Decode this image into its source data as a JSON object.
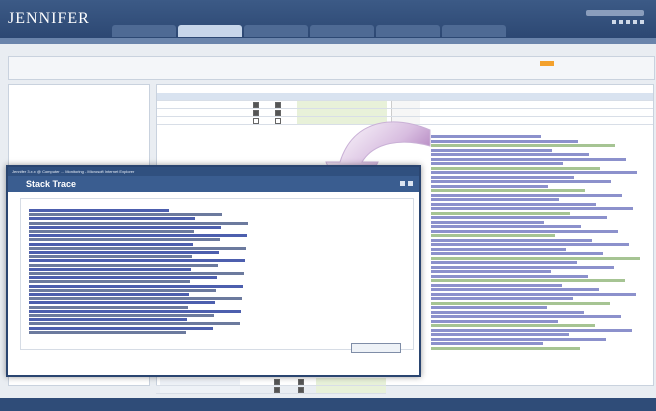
{
  "app": {
    "logo": "JENNIFER"
  },
  "tabs": [
    "",
    "",
    "",
    "",
    "",
    ""
  ],
  "active_tab_index": 1,
  "subnav": [
    "",
    "",
    "",
    ""
  ],
  "letters": [
    "",
    "",
    "",
    "",
    "",
    "",
    "",
    "",
    "",
    "",
    "",
    "",
    "",
    "",
    "",
    "",
    "",
    "",
    "",
    "",
    "",
    "",
    "",
    "",
    "",
    "",
    "",
    "",
    "",
    "",
    "",
    "",
    "",
    "",
    "",
    "",
    "",
    ""
  ],
  "active_letter_index": 31,
  "tree": {
    "items": [
      "",
      "",
      "",
      "",
      "",
      "",
      "",
      "",
      ""
    ]
  },
  "table": {
    "title": "",
    "headers": [
      "",
      "",
      "",
      "",
      "",
      ""
    ],
    "rows": [
      {
        "name": "",
        "c1": true,
        "c2": true,
        "timeout": ""
      },
      {
        "name": "",
        "c1": true,
        "c2": true,
        "timeout": ""
      },
      {
        "name": "",
        "c1": false,
        "c2": false,
        "timeout": ""
      }
    ]
  },
  "dialog": {
    "window_title": "Jennifer 3.x.x @ Computer ... Monitoring - Microsoft Internet Explorer",
    "title": "Stack Trace",
    "back_button": ""
  },
  "status": {
    "text": ""
  },
  "colors": {
    "arrow": "#7a2f8f",
    "accent": "#f3a12d",
    "header": "#30507f"
  }
}
